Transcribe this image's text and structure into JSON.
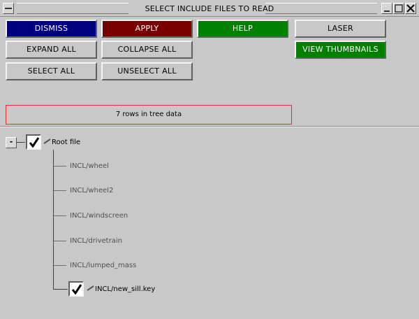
{
  "window": {
    "title": "SELECT INCLUDE FILES TO READ"
  },
  "buttons": {
    "dismiss": "DISMISS",
    "apply": "APPLY",
    "help": "HELP",
    "laser": "LASER",
    "expand_all": "EXPAND ALL",
    "collapse_all": "COLLAPSE ALL",
    "view_thumbnails": "VIEW THUMBNAILS",
    "select_all": "SELECT ALL",
    "unselect_all": "UNSELECT ALL"
  },
  "status": {
    "text": "7 rows in tree data"
  },
  "tree": {
    "toggle": "-",
    "root": {
      "label": "Root file",
      "checked": true
    },
    "children": [
      {
        "label": "INCL/wheel",
        "checked": false
      },
      {
        "label": "INCL/wheel2",
        "checked": false
      },
      {
        "label": "INCL/windscreen",
        "checked": false
      },
      {
        "label": "INCL/drivetrain",
        "checked": false
      },
      {
        "label": "INCL/lumped_mass",
        "checked": false
      },
      {
        "label": "INCL/new_sill.key",
        "checked": true
      }
    ]
  },
  "colors": {
    "dismiss_bg": "#000080",
    "apply_bg": "#7a0000",
    "help_bg": "#008000",
    "view_thumbnails_bg": "#008000",
    "status_border": "#e03030",
    "background": "#c8c8c8"
  }
}
